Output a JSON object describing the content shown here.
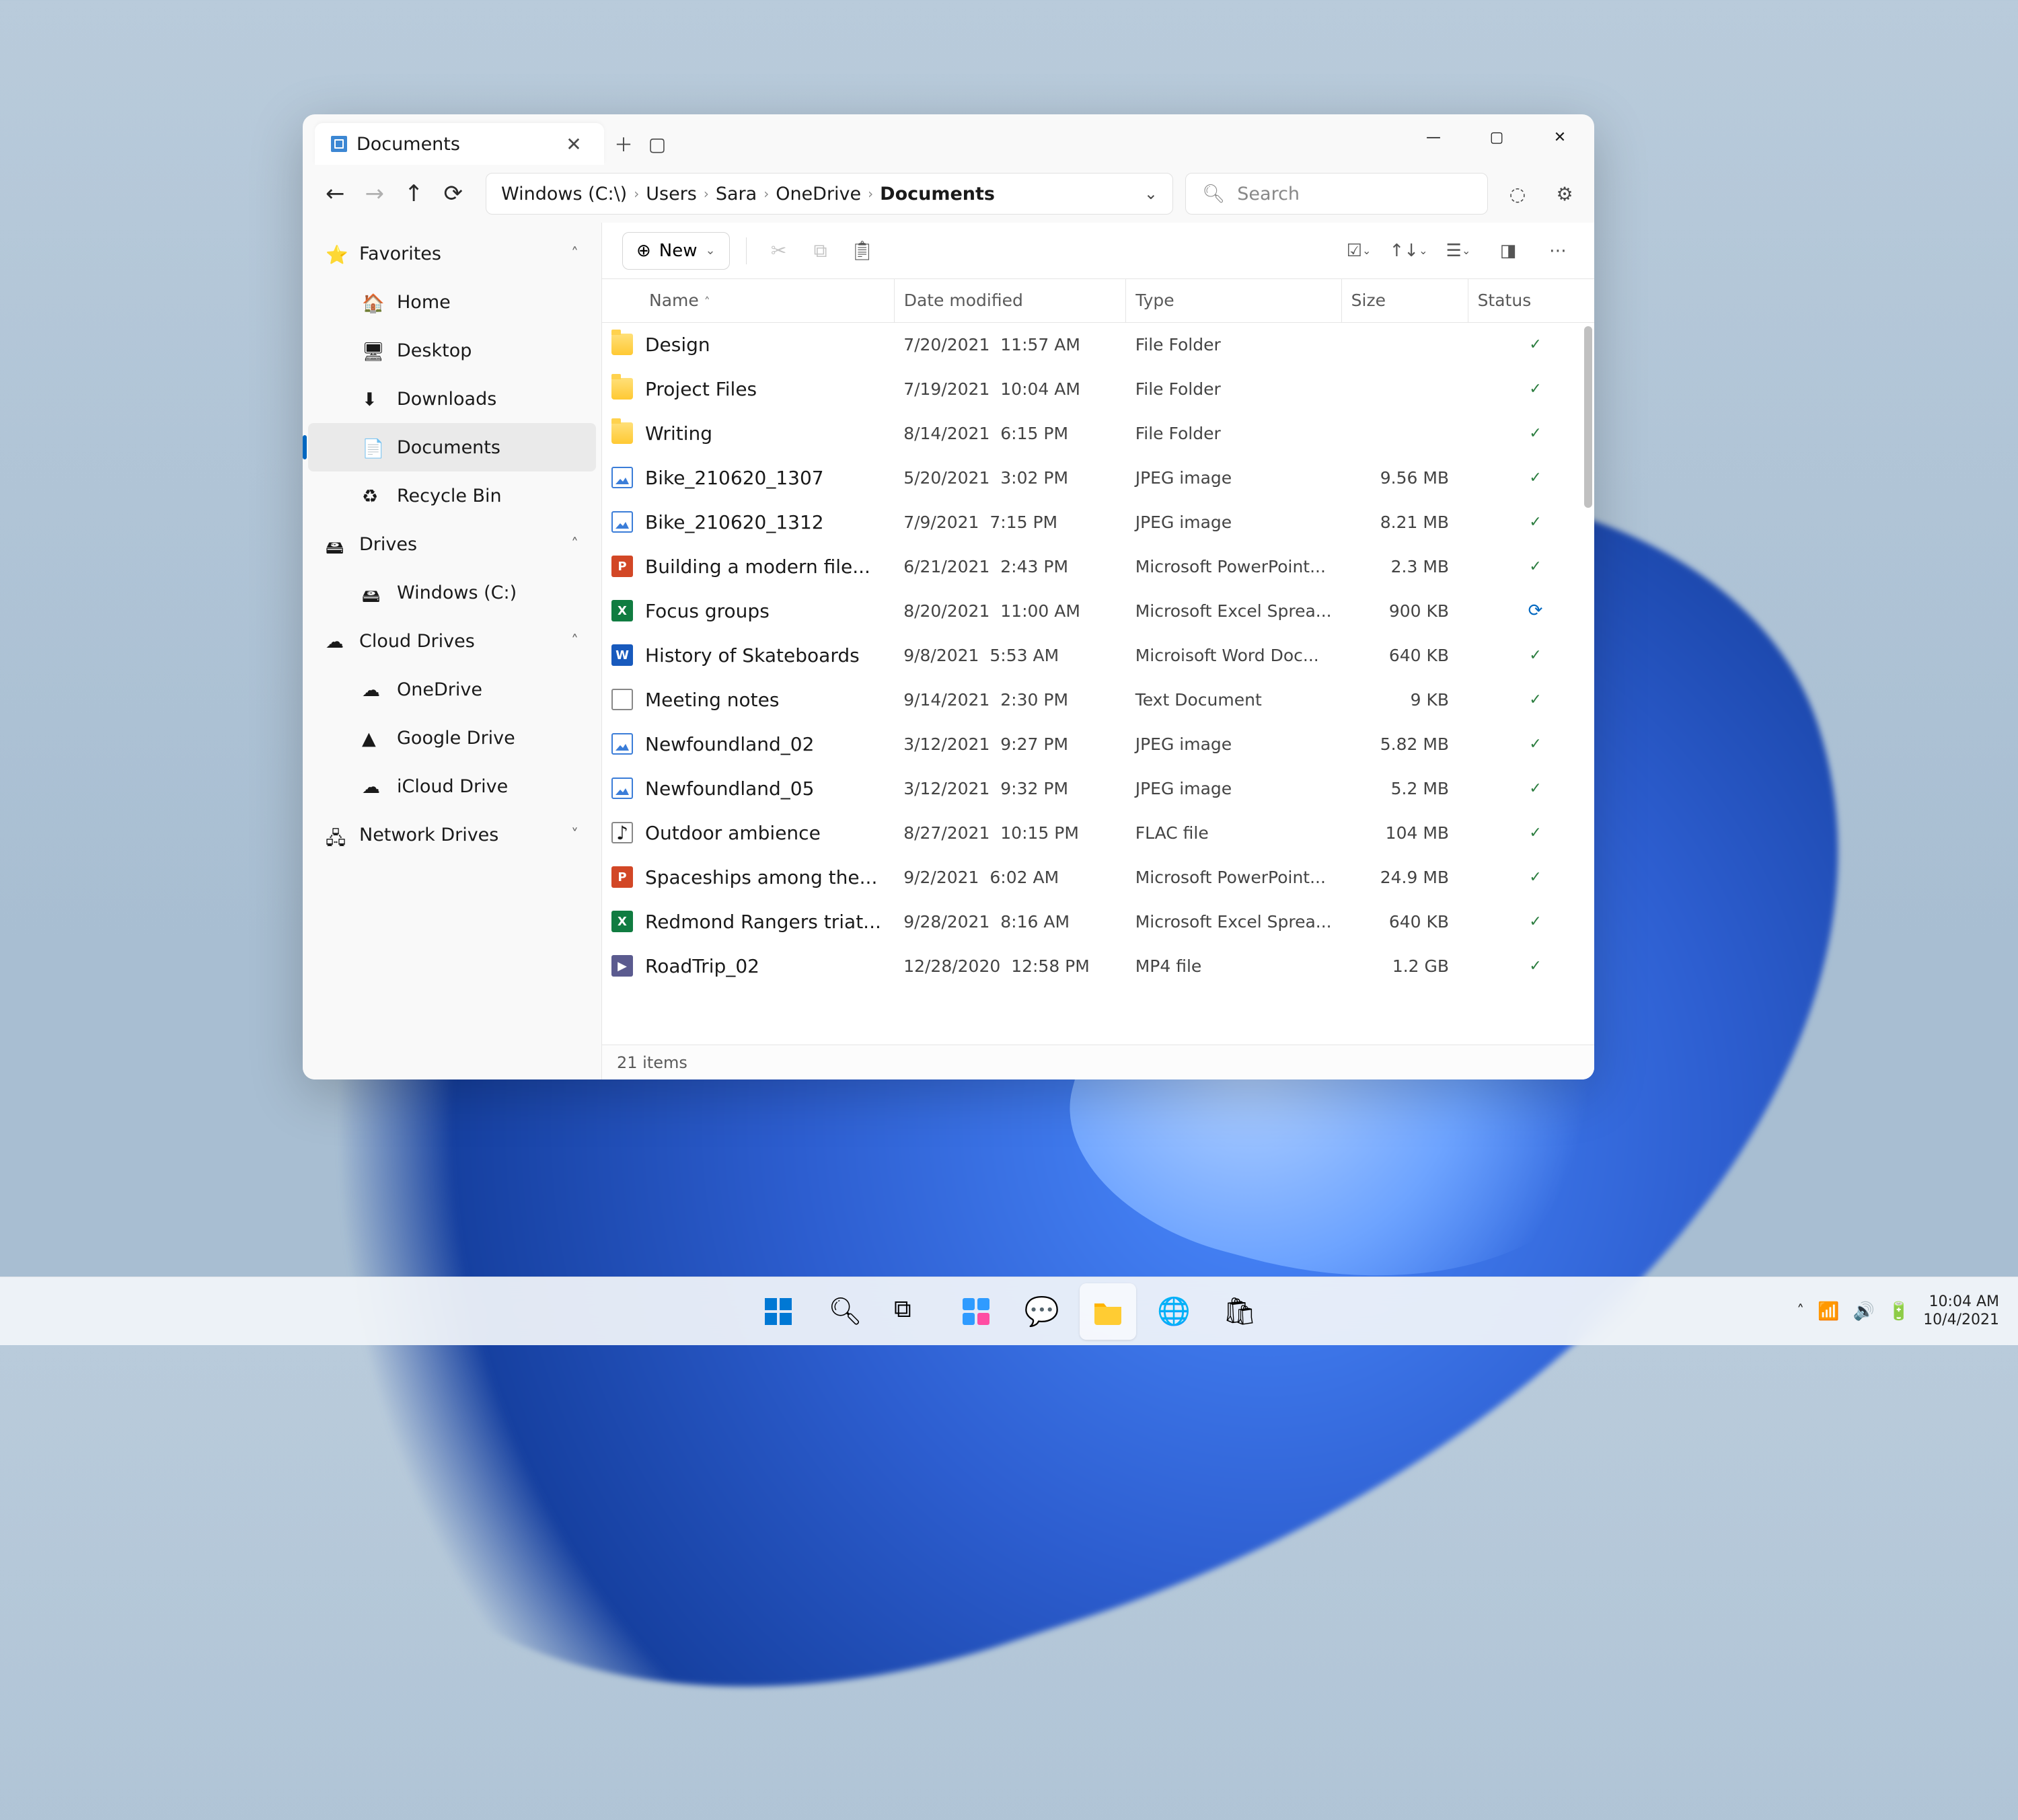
{
  "tab": {
    "title": "Documents"
  },
  "breadcrumb": [
    "Windows (C:\\)",
    "Users",
    "Sara",
    "OneDrive",
    "Documents"
  ],
  "search": {
    "placeholder": "Search"
  },
  "commandbar": {
    "new_label": "New"
  },
  "sidebar": {
    "sections": [
      {
        "label": "Favorites",
        "icon": "star",
        "expanded": true,
        "items": [
          {
            "label": "Home",
            "icon": "home"
          },
          {
            "label": "Desktop",
            "icon": "desktop"
          },
          {
            "label": "Downloads",
            "icon": "download"
          },
          {
            "label": "Documents",
            "icon": "document",
            "selected": true
          },
          {
            "label": "Recycle Bin",
            "icon": "recycle"
          }
        ]
      },
      {
        "label": "Drives",
        "icon": "drives",
        "expanded": true,
        "items": [
          {
            "label": "Windows (C:)",
            "icon": "drive"
          }
        ]
      },
      {
        "label": "Cloud Drives",
        "icon": "cloud",
        "expanded": true,
        "items": [
          {
            "label": "OneDrive",
            "icon": "onedrive"
          },
          {
            "label": "Google Drive",
            "icon": "gdrive"
          },
          {
            "label": "iCloud Drive",
            "icon": "icloud"
          }
        ]
      },
      {
        "label": "Network Drives",
        "icon": "network",
        "expanded": false,
        "items": []
      }
    ]
  },
  "columns": {
    "name": "Name",
    "modified": "Date modified",
    "type": "Type",
    "size": "Size",
    "status": "Status"
  },
  "rows": [
    {
      "name": "Design",
      "date": "7/20/2021",
      "time": "11:57 AM",
      "type": "File Folder",
      "size": "",
      "status": "ok",
      "icon": "folder"
    },
    {
      "name": "Project Files",
      "date": "7/19/2021",
      "time": "10:04 AM",
      "type": "File Folder",
      "size": "",
      "status": "ok",
      "icon": "folder"
    },
    {
      "name": "Writing",
      "date": "8/14/2021",
      "time": "6:15 PM",
      "type": "File Folder",
      "size": "",
      "status": "ok",
      "icon": "folder"
    },
    {
      "name": "Bike_210620_1307",
      "date": "5/20/2021",
      "time": "3:02 PM",
      "type": "JPEG image",
      "size": "9.56 MB",
      "status": "ok",
      "icon": "image"
    },
    {
      "name": "Bike_210620_1312",
      "date": "7/9/2021",
      "time": "7:15 PM",
      "type": "JPEG image",
      "size": "8.21 MB",
      "status": "ok",
      "icon": "image"
    },
    {
      "name": "Building a modern file...",
      "date": "6/21/2021",
      "time": "2:43 PM",
      "type": "Microsoft PowerPoint...",
      "size": "2.3 MB",
      "status": "ok",
      "icon": "ppt"
    },
    {
      "name": "Focus groups",
      "date": "8/20/2021",
      "time": "11:00 AM",
      "type": "Microsoft Excel Sprea...",
      "size": "900 KB",
      "status": "sync",
      "icon": "xls"
    },
    {
      "name": "History of Skateboards",
      "date": "9/8/2021",
      "time": "5:53 AM",
      "type": "Microisoft Word Doc...",
      "size": "640 KB",
      "status": "ok",
      "icon": "doc"
    },
    {
      "name": "Meeting notes",
      "date": "9/14/2021",
      "time": "2:30 PM",
      "type": "Text Document",
      "size": "9 KB",
      "status": "ok",
      "icon": "txt"
    },
    {
      "name": "Newfoundland_02",
      "date": "3/12/2021",
      "time": "9:27 PM",
      "type": "JPEG image",
      "size": "5.82 MB",
      "status": "ok",
      "icon": "image"
    },
    {
      "name": "Newfoundland_05",
      "date": "3/12/2021",
      "time": "9:32 PM",
      "type": "JPEG image",
      "size": "5.2 MB",
      "status": "ok",
      "icon": "image"
    },
    {
      "name": "Outdoor ambience",
      "date": "8/27/2021",
      "time": "10:15 PM",
      "type": "FLAC file",
      "size": "104 MB",
      "status": "ok",
      "icon": "audio"
    },
    {
      "name": "Spaceships among the...",
      "date": "9/2/2021",
      "time": "6:02 AM",
      "type": "Microsoft PowerPoint...",
      "size": "24.9 MB",
      "status": "ok",
      "icon": "ppt"
    },
    {
      "name": "Redmond Rangers triat...",
      "date": "9/28/2021",
      "time": "8:16 AM",
      "type": "Microsoft Excel Sprea...",
      "size": "640 KB",
      "status": "ok",
      "icon": "xls"
    },
    {
      "name": "RoadTrip_02",
      "date": "12/28/2020",
      "time": "12:58 PM",
      "type": "MP4 file",
      "size": "1.2 GB",
      "status": "ok",
      "icon": "video"
    }
  ],
  "footer": {
    "item_count_label": "21 items"
  },
  "taskbar": {
    "time": "10:04 AM",
    "date": "10/4/2021"
  }
}
